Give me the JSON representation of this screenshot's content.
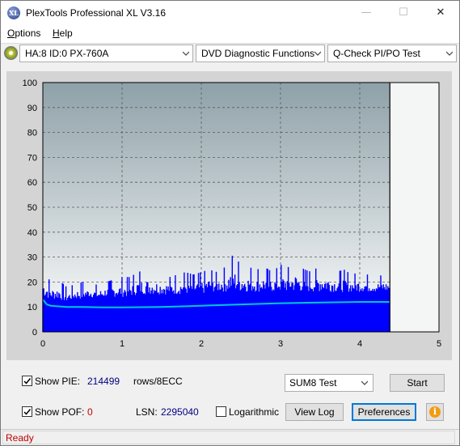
{
  "window": {
    "title": "PlexTools Professional XL V3.16",
    "icon_text": "XL",
    "minimize": "—",
    "maximize": "☐",
    "close": "✕"
  },
  "menu": {
    "items": [
      {
        "label": "Options",
        "underline": "O",
        "rest": "ptions"
      },
      {
        "label": "Help",
        "underline": "H",
        "rest": "elp"
      }
    ]
  },
  "toolbar": {
    "drive": "HA:8 ID:0  PX-760A",
    "function": "DVD Diagnostic Functions",
    "test": "Q-Check PI/PO Test"
  },
  "chart_data": {
    "type": "area",
    "title": "",
    "xlabel": "",
    "ylabel": "",
    "xlim": [
      0,
      5
    ],
    "ylim": [
      0,
      100
    ],
    "x_ticks": [
      "0",
      "1",
      "2",
      "3",
      "4",
      "5"
    ],
    "y_ticks": [
      "0",
      "10",
      "20",
      "30",
      "40",
      "50",
      "60",
      "70",
      "80",
      "90",
      "100"
    ],
    "grid": true,
    "data_end_x": 4.38,
    "series": [
      {
        "type": "bar",
        "color": "#0000ff",
        "x": [
          0.0,
          0.1,
          0.2,
          0.3,
          0.4,
          0.5,
          0.6,
          0.7,
          0.8,
          0.9,
          1.0,
          1.1,
          1.2,
          1.3,
          1.4,
          1.5,
          1.6,
          1.7,
          1.8,
          1.9,
          2.0,
          2.1,
          2.2,
          2.3,
          2.4,
          2.5,
          2.6,
          2.7,
          2.8,
          2.9,
          3.0,
          3.1,
          3.2,
          3.3,
          3.4,
          3.5,
          3.6,
          3.7,
          3.8,
          3.9,
          4.0,
          4.1,
          4.2,
          4.3,
          4.38
        ],
        "values": [
          25,
          20,
          21,
          18,
          19,
          20,
          19,
          19,
          20,
          21,
          22,
          22,
          24,
          25,
          24,
          23,
          22,
          23,
          24,
          23,
          24,
          25,
          24,
          26,
          31,
          27,
          26,
          25,
          26,
          24,
          27,
          26,
          28,
          25,
          24,
          27,
          26,
          24,
          25,
          23,
          24,
          23,
          22,
          23,
          22
        ],
        "baseline_values": [
          14,
          13,
          13,
          12,
          13,
          13,
          14,
          13,
          14,
          14,
          14,
          14,
          15,
          15,
          15,
          15,
          15,
          15,
          15,
          15,
          15,
          16,
          16,
          16,
          16,
          16,
          16,
          16,
          16,
          16,
          16,
          16,
          16,
          16,
          16,
          16,
          16,
          16,
          16,
          16,
          16,
          16,
          16,
          16,
          16
        ]
      },
      {
        "type": "line",
        "color": "#00c8d8",
        "x": [
          0.0,
          0.05,
          0.1,
          0.3,
          0.5,
          0.8,
          1.0,
          1.5,
          2.0,
          2.5,
          3.0,
          3.5,
          4.0,
          4.38
        ],
        "values": [
          13,
          11,
          10.5,
          10,
          10,
          9.8,
          9.8,
          10,
          10.5,
          11,
          11.5,
          11.8,
          12,
          12
        ]
      }
    ]
  },
  "controls": {
    "show_pie_label": "Show PIE:",
    "show_pie_checked": true,
    "pie_value": "214499",
    "pie_unit": "rows/8ECC",
    "show_pof_label": "Show POF:",
    "show_pof_checked": true,
    "pof_value": "0",
    "lsn_label": "LSN:",
    "lsn_value": "2295040",
    "logarithmic_label": "Logarithmic",
    "logarithmic_checked": false,
    "sum_test": "SUM8 Test",
    "start_button": "Start",
    "view_log_button": "View Log",
    "preferences_button": "Preferences",
    "info_icon": "i"
  },
  "status": {
    "text": "Ready"
  }
}
